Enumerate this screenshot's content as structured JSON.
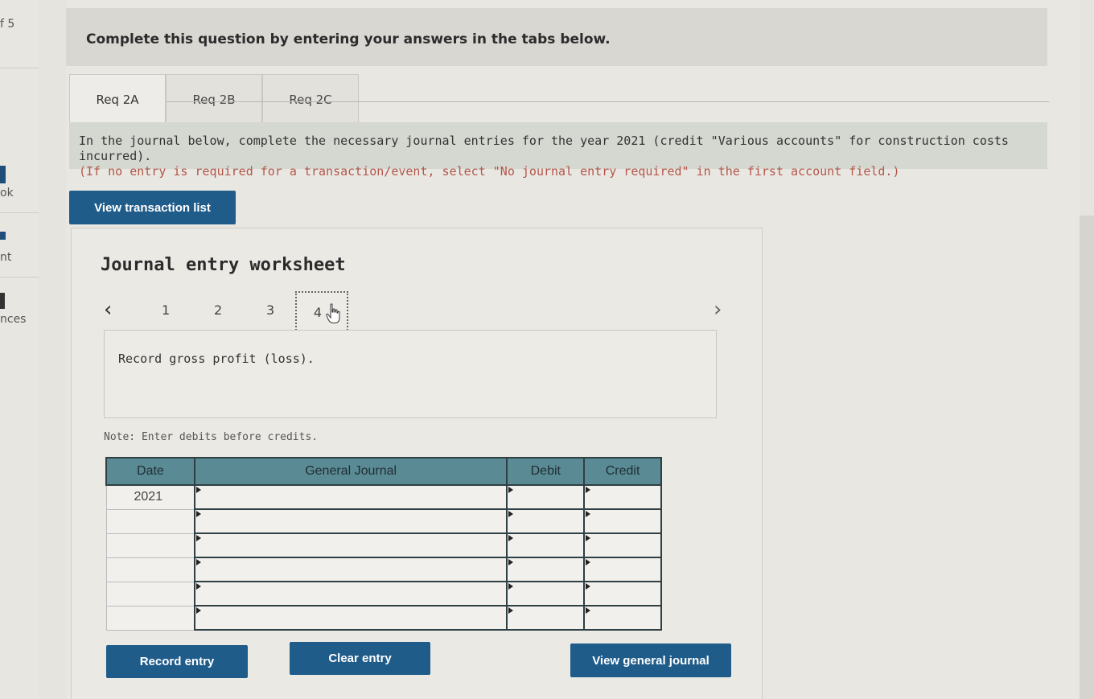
{
  "sidebar": {
    "fragments": [
      "f 5",
      "ok",
      "nt",
      "nces"
    ]
  },
  "header": {
    "text": "Complete this question by entering your answers in the tabs below."
  },
  "tabs": [
    {
      "label": "Req 2A",
      "active": true
    },
    {
      "label": "Req 2B",
      "active": false
    },
    {
      "label": "Req 2C",
      "active": false
    }
  ],
  "instructions": {
    "main": "In the journal below, complete the necessary journal entries for the year 2021 (credit \"Various accounts\" for construction costs incurred).",
    "note": "(If no entry is required for a transaction/event, select \"No journal entry required\" in the first account field.)"
  },
  "buttons": {
    "view_transaction_list": "View transaction list",
    "record_entry": "Record entry",
    "clear_entry": "Clear entry",
    "view_general_journal": "View general journal"
  },
  "worksheet": {
    "title": "Journal entry worksheet",
    "pages": [
      "1",
      "2",
      "3",
      "4"
    ],
    "current_page": "4",
    "description": "Record gross profit (loss).",
    "note": "Note: Enter debits before credits."
  },
  "journal": {
    "headers": {
      "date": "Date",
      "general_journal": "General Journal",
      "debit": "Debit",
      "credit": "Credit"
    },
    "rows": [
      {
        "date": "2021",
        "account": "",
        "debit": "",
        "credit": ""
      },
      {
        "date": "",
        "account": "",
        "debit": "",
        "credit": ""
      },
      {
        "date": "",
        "account": "",
        "debit": "",
        "credit": ""
      },
      {
        "date": "",
        "account": "",
        "debit": "",
        "credit": ""
      },
      {
        "date": "",
        "account": "",
        "debit": "",
        "credit": ""
      },
      {
        "date": "",
        "account": "",
        "debit": "",
        "credit": ""
      }
    ]
  },
  "colors": {
    "button": "#1f5c8a",
    "table_header": "#5a8a94",
    "instruction_bg": "#d4d8d0",
    "note_red": "#b2564a"
  }
}
